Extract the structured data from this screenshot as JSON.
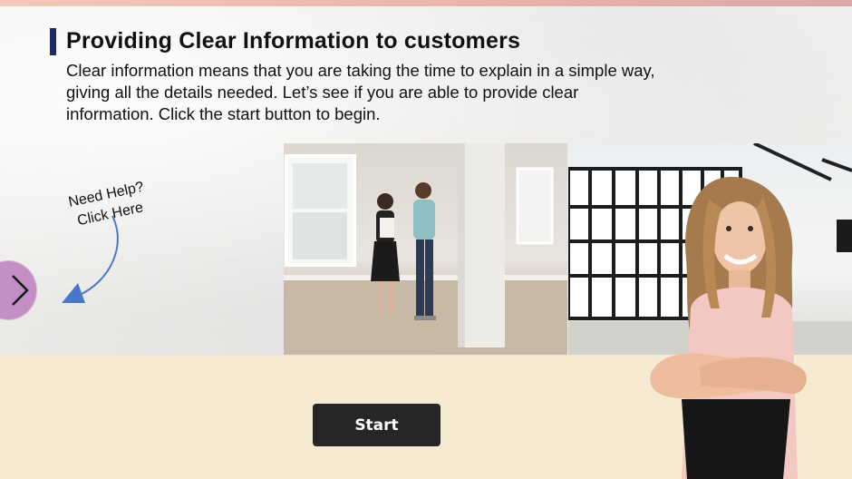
{
  "lesson": {
    "title": "Providing Clear Information to customers",
    "description": "Clear information means that you are taking the time to explain in a simple way, giving all the details needed. Let’s see if you are able to provide clear information. Click the start button to begin."
  },
  "help": {
    "line1": "Need Help?",
    "line2": "Click Here"
  },
  "actions": {
    "start_label": "Start"
  },
  "colors": {
    "accent_bar": "#1e2b6b",
    "nav_button": "#c48fc4",
    "start_button": "#262626",
    "bottom_band": "#f6ead3",
    "arrow": "#4a78c8"
  },
  "icons": {
    "nav": "chevron-right-icon",
    "help_arrow": "curved-arrow-icon"
  }
}
